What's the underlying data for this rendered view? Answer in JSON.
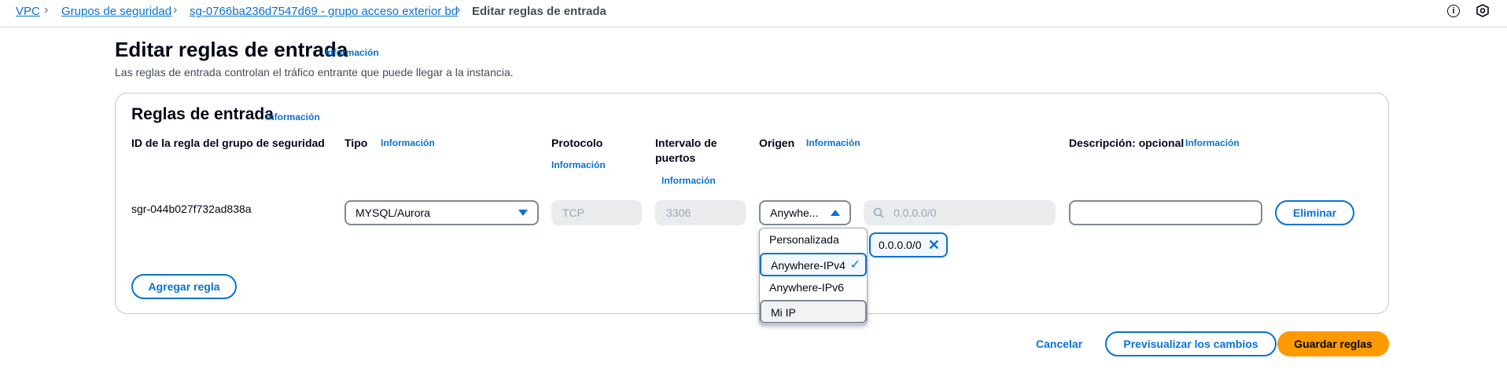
{
  "breadcrumb": {
    "vpc": "VPC",
    "security_groups": "Grupos de seguridad",
    "security_group": "sg-0766ba236d7547d69 - grupo acceso exterior bd",
    "current": "Editar reglas de entrada"
  },
  "header": {
    "title": "Editar reglas de entrada",
    "info": "Información",
    "description": "Las reglas de entrada controlan el tráfico entrante que puede llegar a la instancia."
  },
  "panel": {
    "title": "Reglas de entrada",
    "info": "Información",
    "columns": {
      "rule_id": "ID de la regla del grupo de seguridad",
      "type": "Tipo",
      "type_info": "Información",
      "protocol": "Protocolo",
      "protocol_info": "Información",
      "port_range_line1": "Intervalo de",
      "port_range_line2": "puertos",
      "port_range_info": "Información",
      "source": "Origen",
      "source_info": "Información",
      "description": "Descripción: opcional",
      "description_info": "Información"
    },
    "rule": {
      "id": "sgr-044b027f732ad838a",
      "type": "MYSQL/Aurora",
      "protocol": "TCP",
      "port_range": "3306",
      "source_selected": "Anywhe...",
      "cidr_placeholder": "0.0.0.0/0",
      "cidr_token": "0.0.0.0/0",
      "description_value": "",
      "delete_label": "Eliminar"
    },
    "source_options": [
      "Personalizada",
      "Anywhere-IPv4",
      "Anywhere-IPv6",
      "Mi IP"
    ],
    "source_option_selected": "Anywhere-IPv4",
    "add_rule_label": "Agregar regla"
  },
  "footer": {
    "cancel": "Cancelar",
    "preview": "Previsualizar los cambios",
    "save": "Guardar reglas"
  },
  "colors": {
    "accent": "#0972d3",
    "primary_button": "#ff9900",
    "text": "#000716"
  },
  "icons": {
    "info": "info-circle-icon",
    "hex": "settings-hex-icon",
    "search": "search-icon",
    "check": "check-icon",
    "remove": "close-icon"
  }
}
